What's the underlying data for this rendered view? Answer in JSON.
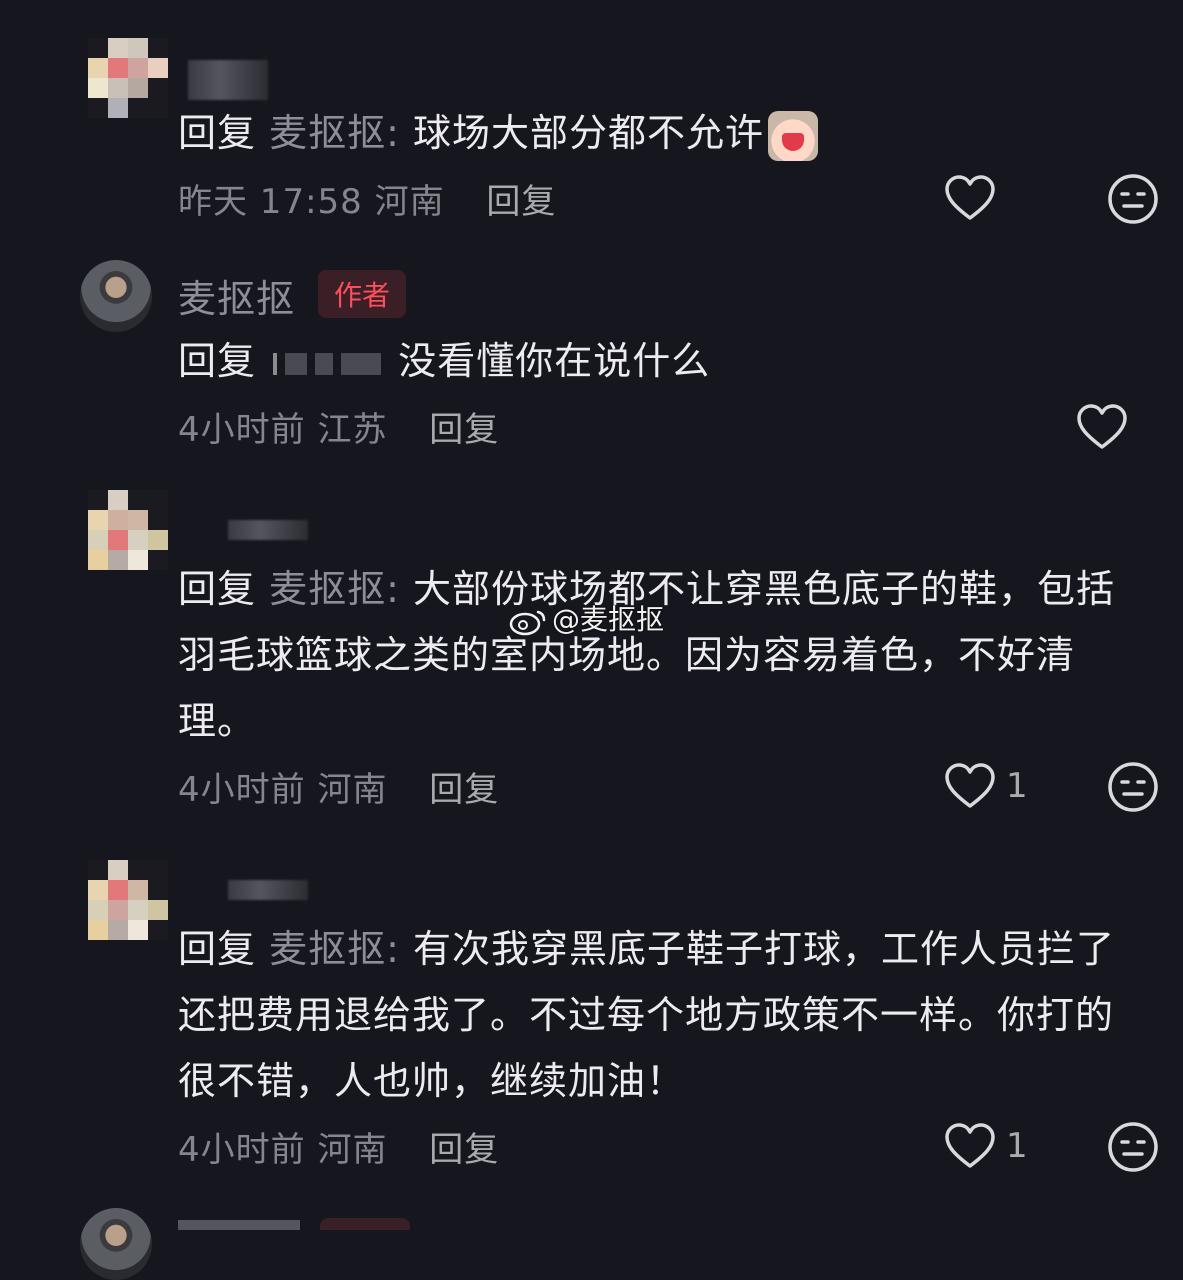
{
  "comments": [
    {
      "reply_prefix": "回复",
      "reply_to": "麦抠抠:",
      "body": "球场大部分都不允许",
      "time": "昨天 17:58",
      "location": "河南",
      "reply_button": "回复",
      "likes": ""
    },
    {
      "author": "麦抠抠",
      "author_badge": "作者",
      "reply_prefix": "回复",
      "body": "没看懂你在说什么",
      "time": "4小时前",
      "location": "江苏",
      "reply_button": "回复",
      "likes": ""
    },
    {
      "reply_prefix": "回复",
      "reply_to": "麦抠抠:",
      "body": "大部份球场都不让穿黑色底子的鞋，包括羽毛球篮球之类的室内场地。因为容易着色，不好清理。",
      "time": "4小时前",
      "location": "河南",
      "reply_button": "回复",
      "likes": "1"
    },
    {
      "reply_prefix": "回复",
      "reply_to": "麦抠抠:",
      "body": "有次我穿黑底子鞋子打球，工作人员拦了还把费用退给我了。不过每个地方政策不一样。你打的很不错，人也帅，继续加油！",
      "time": "4小时前",
      "location": "河南",
      "reply_button": "回复",
      "likes": "1"
    }
  ],
  "watermark": "@麦抠抠",
  "colors": {
    "background": "#16161e",
    "author_badge": "#ff4d5a",
    "meta": "#85858d"
  }
}
